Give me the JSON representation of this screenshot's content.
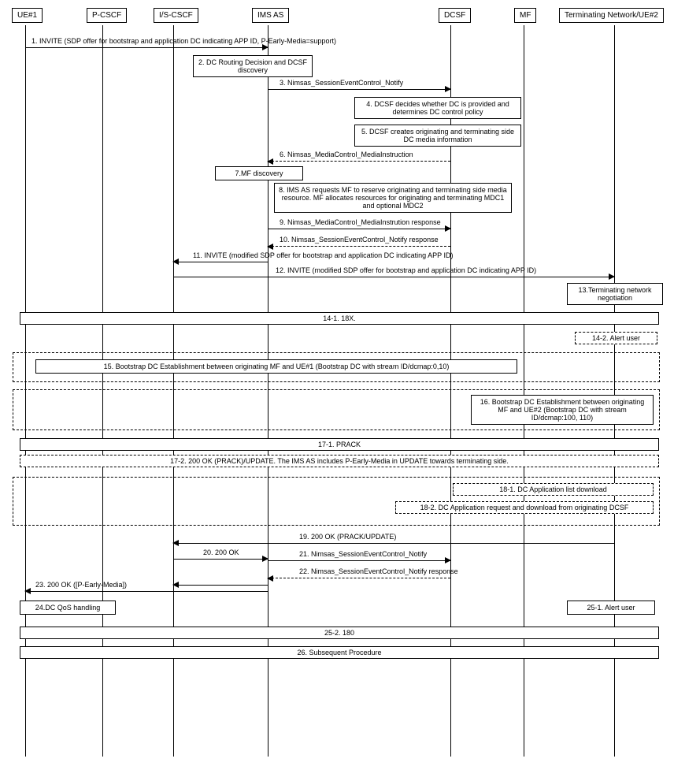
{
  "participants": {
    "ue1": "UE#1",
    "pcscf": "P-CSCF",
    "iscscf": "I/S-CSCF",
    "imsas": "IMS AS",
    "dcsf": "DCSF",
    "mf": "MF",
    "term": "Terminating Network/UE#2"
  },
  "messages": {
    "m1": "1. INVITE (SDP offer for bootstrap and application DC indicating APP ID, P-Early-Media=support)",
    "m2": "2. DC Routing Decision and DCSF discovery",
    "m3": "3. Nimsas_SessionEventControl_Notify",
    "m4": "4. DCSF decides whether DC is provided and determines DC control policy",
    "m5": "5. DCSF creates originating and terminating side DC media information",
    "m6": "6. Nimsas_MediaControl_MediaInstruction",
    "m7": "7.MF discovery",
    "m8": "8.  IMS AS requests MF to reserve originating and terminating side media resource. MF allocates resources for originating and terminating MDC1 and optional MDC2",
    "m9": "9. Nimsas_MediaControl_MediaInstrution response",
    "m10": "10. Nimsas_SessionEventControl_Notify response",
    "m11": "11. INVITE (modified SDP offer for bootstrap and application DC indicating APP ID)",
    "m12": "12. INVITE (modified SDP offer for bootstrap and application DC indicating APP ID)",
    "m13": "13.Terminating network negotiation",
    "m14_1": "14-1. 18X.",
    "m14_2": "14-2. Alert user",
    "m15": "15. Bootstrap DC Establishment between originating MF and UE#1 (Bootstrap DC with stream ID/dcmap:0,10)",
    "m16": "16. Bootstrap DC Establishment between originating MF and UE#2 (Bootstrap DC with stream ID/dcmap:100, 110)",
    "m17_1": "17-1. PRACK",
    "m17_2": "17-2. 200 OK (PRACK)/UPDATE. The IMS AS includes P-Early-Media in UPDATE towards terminating side.",
    "m18_1": "18-1. DC Application list download",
    "m18_2": "18-2. DC Application request and download from originating DCSF",
    "m19": "19. 200 OK (PRACK/UPDATE)",
    "m20": "20. 200 OK",
    "m21": "21. Nimsas_SessionEventControl_Notify",
    "m22": "22. Nimsas_SessionEventControl_Notify response",
    "m23": "23. 200 OK ([P-Early-Media])",
    "m24": "24.DC QoS handling",
    "m25_1": "25-1. Alert user",
    "m25_2": "25-2. 180",
    "m26": "26. Subsequent Procedure"
  }
}
